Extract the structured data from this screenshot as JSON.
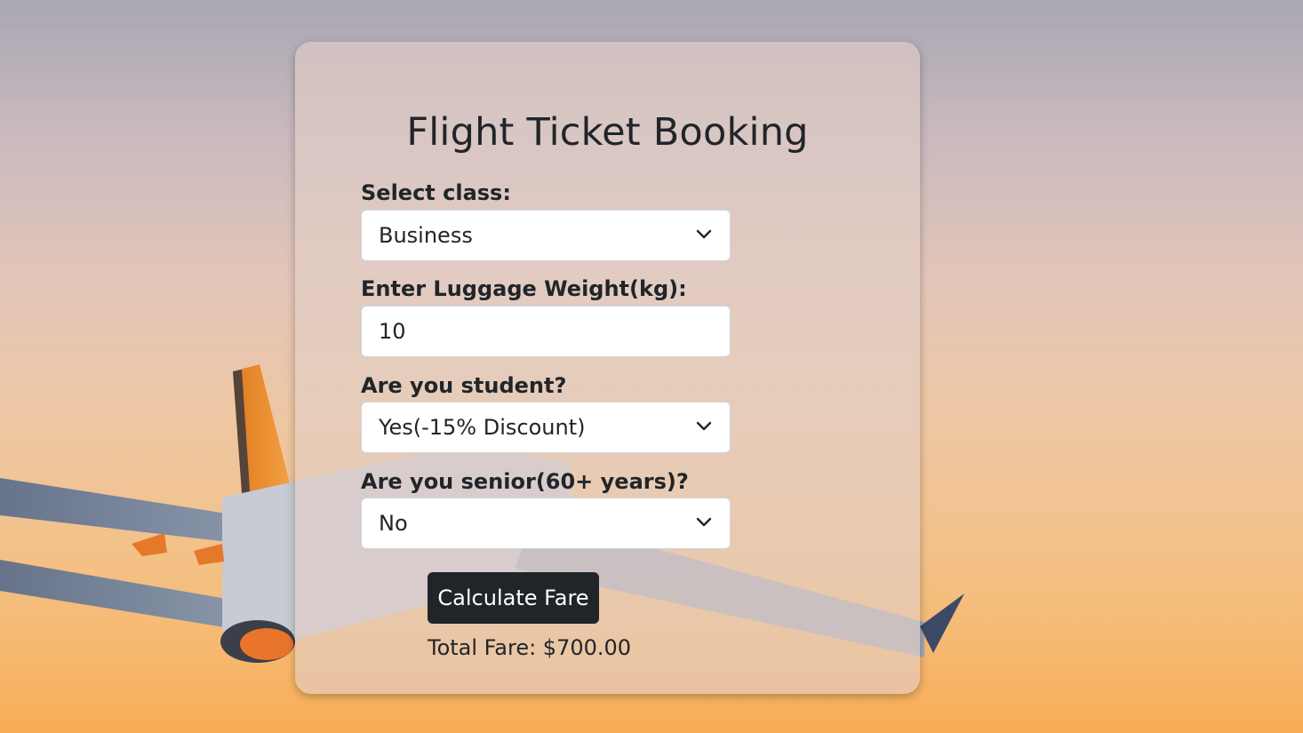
{
  "page": {
    "title": "Flight Ticket Booking"
  },
  "form": {
    "class_label": "Select class:",
    "class_value": "Business",
    "luggage_label": "Enter Luggage Weight(kg):",
    "luggage_value": "10",
    "student_label": "Are you student?",
    "student_value": "Yes(-15% Discount)",
    "senior_label": "Are you senior(60+ years)?",
    "senior_value": "No",
    "calculate_label": "Calculate Fare",
    "total_text": "Total Fare: $700.00"
  },
  "colors": {
    "button_bg": "#212529",
    "text": "#212529",
    "card_bg": "rgba(226,206,198,0.62)"
  },
  "icons": {
    "select_arrow": "chevron-down-icon",
    "background": "airplane-icon"
  }
}
